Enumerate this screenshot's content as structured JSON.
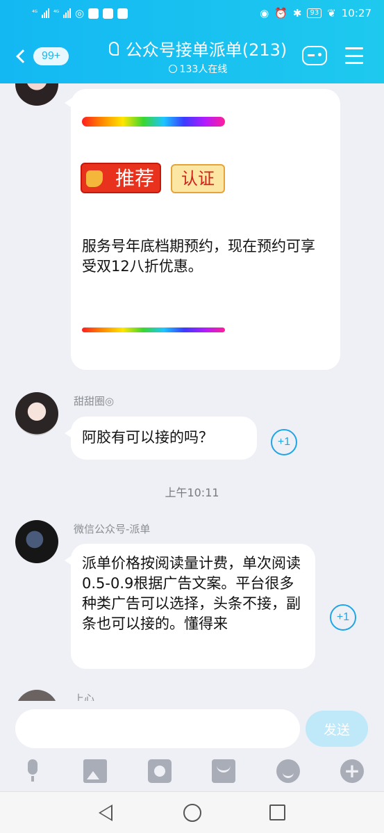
{
  "status_bar": {
    "network_left": "⁴ᴳ",
    "network_right": "⁴ᴳ",
    "battery": "93",
    "time": "10:27"
  },
  "header": {
    "back_badge": "99+",
    "title": "公众号接单派单(213)",
    "online": "133人在线"
  },
  "messages": [
    {
      "sender": "",
      "tag_recommend": "推荐",
      "tag_certified": "认证",
      "text": "服务号年底档期预约，现在预约可享受双12八折优惠。"
    },
    {
      "sender": "甜甜圈◎",
      "text": "阿胶有可以接的吗？",
      "plus_one": "+1"
    },
    {
      "timestamp": "上午10:11"
    },
    {
      "sender": "微信公众号-派单",
      "text": "派单价格按阅读量计费，单次阅读0.5-0.9根据广告文案。平台很多种类广告可以选择，头条不接，副条也可以接的。懂得来",
      "plus_one": "+1"
    },
    {
      "sender": "上心"
    }
  ],
  "input": {
    "placeholder": "",
    "send_label": "发送"
  },
  "colors": {
    "header": "#13b8f3",
    "send_button": "#bfe8f9",
    "accent": "#1fa5e6"
  }
}
